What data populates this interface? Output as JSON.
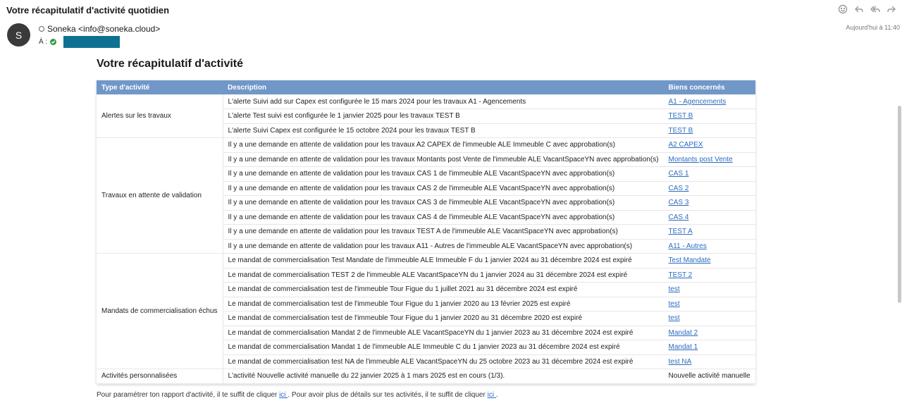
{
  "email": {
    "subject": "Votre récapitulatif d'activité quotidien",
    "avatar_letter": "S",
    "from": "Soneka <info@soneka.cloud>",
    "to_label": "À :",
    "date": "Aujourd'hui à 11:40"
  },
  "toolbar": {
    "icons": [
      "smiley-icon",
      "reply-icon",
      "reply-all-icon",
      "forward-icon"
    ]
  },
  "content": {
    "title": "Votre récapitulatif d'activité",
    "headers": [
      "Type d'activité",
      "Description",
      "Biens concernés"
    ],
    "groups": [
      {
        "type": "Alertes sur les travaux",
        "rows": [
          {
            "desc": "L'alerte Suivi add sur Capex est configurée le 15 mars 2024 pour les travaux A1 - Agencements",
            "bien": "A1 - Agencements",
            "link": true
          },
          {
            "desc": "L'alerte Test suivi est configurée le 1 janvier 2025 pour les travaux TEST B",
            "bien": "TEST B",
            "link": true
          },
          {
            "desc": "L'alerte Suivi Capex est configurée le 15 octobre 2024 pour les travaux TEST B",
            "bien": "TEST B",
            "link": true
          }
        ]
      },
      {
        "type": "Travaux en attente de validation",
        "rows": [
          {
            "desc": "Il y a une demande en attente de validation pour les travaux A2 CAPEX de l'immeuble ALE Immeuble C avec approbation(s)",
            "bien": "A2 CAPEX",
            "link": true
          },
          {
            "desc": "Il y a une demande en attente de validation pour les travaux Montants post Vente de l'immeuble ALE VacantSpaceYN avec approbation(s)",
            "bien": "Montants post Vente",
            "link": true
          },
          {
            "desc": "Il y a une demande en attente de validation pour les travaux CAS 1 de l'immeuble ALE VacantSpaceYN avec approbation(s)",
            "bien": "CAS 1",
            "link": true
          },
          {
            "desc": "Il y a une demande en attente de validation pour les travaux CAS 2 de l'immeuble ALE VacantSpaceYN avec approbation(s)",
            "bien": "CAS 2",
            "link": true
          },
          {
            "desc": "Il y a une demande en attente de validation pour les travaux CAS 3 de l'immeuble ALE VacantSpaceYN avec approbation(s)",
            "bien": "CAS 3",
            "link": true
          },
          {
            "desc": "Il y a une demande en attente de validation pour les travaux CAS 4 de l'immeuble ALE VacantSpaceYN avec approbation(s)",
            "bien": "CAS 4",
            "link": true
          },
          {
            "desc": "Il y a une demande en attente de validation pour les travaux TEST A de l'immeuble ALE VacantSpaceYN avec approbation(s)",
            "bien": "TEST A",
            "link": true
          },
          {
            "desc": "Il y a une demande en attente de validation pour les travaux A11 - Autres de l'immeuble ALE VacantSpaceYN avec approbation(s)",
            "bien": "A11 - Autres",
            "link": true
          }
        ]
      },
      {
        "type": "Mandats de commercialisation échus",
        "rows": [
          {
            "desc": "Le mandat de commercialisation Test Mandate de l'immeuble ALE Immeuble F du 1 janvier 2024 au 31 décembre 2024 est expiré",
            "bien": "Test Mandate",
            "link": true
          },
          {
            "desc": "Le mandat de commercialisation TEST 2 de l'immeuble ALE VacantSpaceYN du 1 janvier 2024 au 31 décembre 2024 est expiré",
            "bien": "TEST 2",
            "link": true
          },
          {
            "desc": "Le mandat de commercialisation test de l'immeuble Tour Figue du 1 juillet 2021 au 31 décembre 2024 est expiré",
            "bien": "test",
            "link": true
          },
          {
            "desc": "Le mandat de commercialisation test de l'immeuble Tour Figue du 1 janvier 2020 au 13 février 2025 est expiré",
            "bien": "test",
            "link": true
          },
          {
            "desc": "Le mandat de commercialisation test de l'immeuble Tour Figue du 1 janvier 2020 au 31 décembre 2020 est expiré",
            "bien": "test",
            "link": true
          },
          {
            "desc": "Le mandat de commercialisation Mandat 2 de l'immeuble ALE VacantSpaceYN du 1 janvier 2023 au 31 décembre 2024 est expiré",
            "bien": "Mandat 2",
            "link": true
          },
          {
            "desc": "Le mandat de commercialisation Mandat 1 de l'immeuble ALE Immeuble C du 1 janvier 2023 au 31 décembre 2024 est expiré",
            "bien": "Mandat 1",
            "link": true
          },
          {
            "desc": "Le mandat de commercialisation test NA de l'immeuble ALE VacantSpaceYN du 25 octobre 2023 au 31 décembre 2024 est expiré",
            "bien": "test NA",
            "link": true
          }
        ]
      },
      {
        "type": "Activités personnalisées",
        "rows": [
          {
            "desc": "L'activité Nouvelle activité manuelle du 22 janvier 2025 à 1 mars 2025 est en cours (1/3).",
            "bien": "Nouvelle activité manuelle",
            "link": false
          }
        ]
      }
    ],
    "footer": {
      "part1": "Pour paramétrer ton rapport d'activité, il te suffit de cliquer ",
      "link1": "ici ",
      "part2": ". Pour avoir plus de détails sur tes activités, il te suffit de cliquer ",
      "link2": "ici ",
      "part3": "."
    }
  }
}
